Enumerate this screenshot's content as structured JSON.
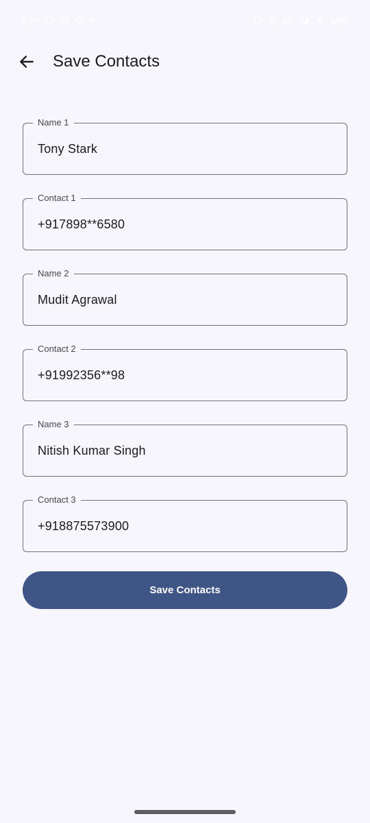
{
  "status_bar": {
    "time": "2:48",
    "network": "4G",
    "battery": "98%"
  },
  "app_bar": {
    "title": "Save Contacts",
    "back_icon": "arrow-left-icon"
  },
  "form": {
    "fields": [
      {
        "label": "Name 1",
        "value": "Tony Stark"
      },
      {
        "label": "Contact 1",
        "value": "+917898**6580"
      },
      {
        "label": "Name 2",
        "value": "Mudit Agrawal"
      },
      {
        "label": "Contact 2",
        "value": "+91992356**98"
      },
      {
        "label": "Name 3",
        "value": "Nitish Kumar Singh"
      },
      {
        "label": "Contact 3",
        "value": "+918875573900"
      }
    ],
    "save_label": "Save Contacts"
  },
  "colors": {
    "background": "#f7f6fc",
    "button": "#3f5585",
    "outline": "#6e6f78"
  }
}
